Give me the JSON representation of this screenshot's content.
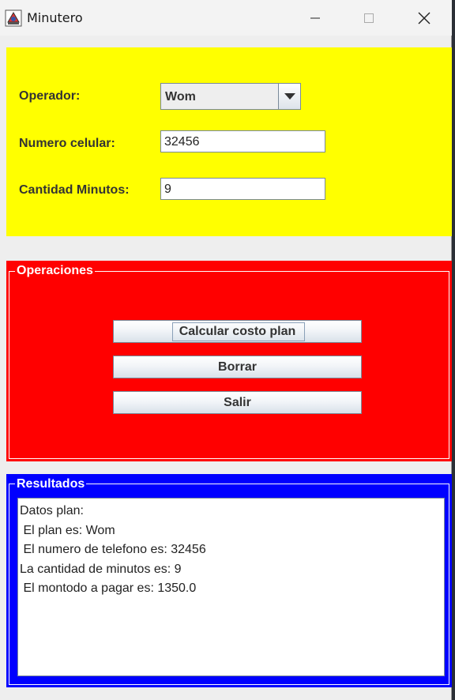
{
  "window": {
    "title": "Minutero"
  },
  "form": {
    "operador_label": "Operador:",
    "operador_value": "Wom",
    "celular_label": "Numero celular:",
    "celular_value": "32456",
    "minutos_label": "Cantidad Minutos:",
    "minutos_value": "9"
  },
  "operaciones": {
    "title": "Operaciones",
    "calcular_label": "Calcular costo plan",
    "borrar_label": "Borrar",
    "salir_label": "Salir"
  },
  "resultados": {
    "title": "Resultados",
    "lines": [
      "Datos plan:",
      " El plan es: Wom",
      " El numero de telefono es: 32456",
      "La cantidad de minutos es: 9",
      " El montodo a pagar es: 1350.0"
    ]
  },
  "colors": {
    "datos_panel": "#ffff00",
    "operaciones_panel": "#ff0000",
    "resultados_panel": "#0000ff"
  },
  "icons": {
    "app": "java-app-icon",
    "minimize": "minimize-icon",
    "maximize": "maximize-icon",
    "close": "close-icon",
    "dropdown": "triangle-down-icon"
  }
}
